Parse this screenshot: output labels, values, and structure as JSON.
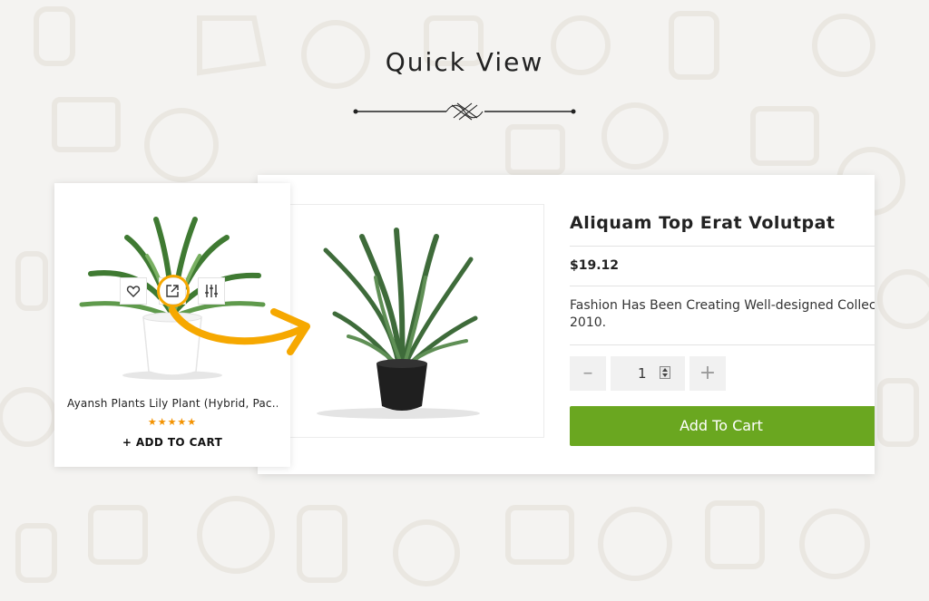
{
  "heading": "Quick View",
  "colors": {
    "accent_green": "#6aa720",
    "highlight": "#f6a800",
    "star": "#f39200",
    "background": "#f4f3f1"
  },
  "quick_view": {
    "title": "Aliquam Top Erat Volutpat",
    "price": "$19.12",
    "description": "Fashion Has Been Creating Well-designed Collec 2010.",
    "quantity": "1",
    "minus_label": "–",
    "plus_label": "+",
    "add_to_cart_label": "Add To Cart"
  },
  "product_card": {
    "name": "Ayansh Plants Lily Plant (Hybrid, Pac...",
    "rating": 5,
    "stars_text": "★★★★★",
    "add_to_cart_label": "+ ADD TO CART",
    "actions": [
      {
        "icon": "heart-icon"
      },
      {
        "icon": "external-link-icon"
      },
      {
        "icon": "sliders-icon"
      }
    ]
  }
}
